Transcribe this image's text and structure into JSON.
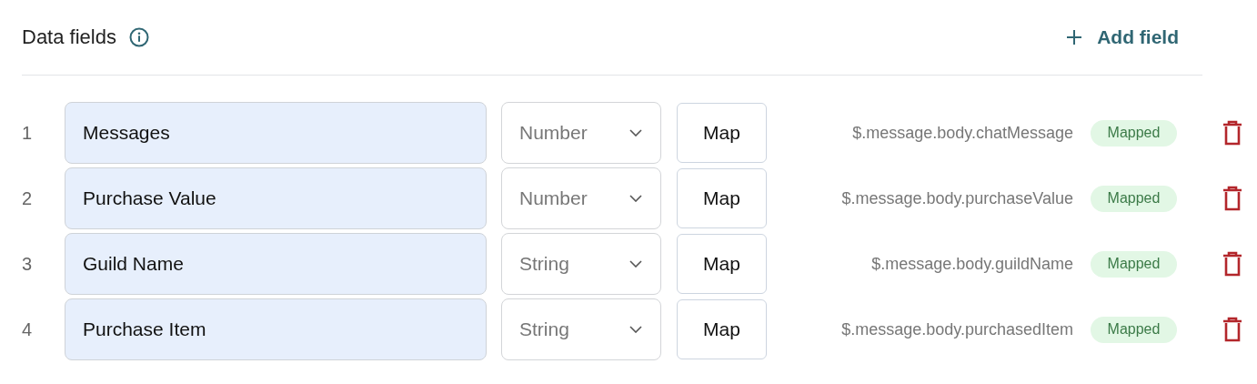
{
  "header": {
    "title": "Data fields",
    "add_button": "Add field"
  },
  "rows": [
    {
      "index": "1",
      "name": "Messages",
      "type": "Number",
      "map_button": "Map",
      "path": "$.message.body.chatMessage",
      "status": "Mapped"
    },
    {
      "index": "2",
      "name": "Purchase Value",
      "type": "Number",
      "map_button": "Map",
      "path": "$.message.body.purchaseValue",
      "status": "Mapped"
    },
    {
      "index": "3",
      "name": "Guild Name",
      "type": "String",
      "map_button": "Map",
      "path": "$.message.body.guildName",
      "status": "Mapped"
    },
    {
      "index": "4",
      "name": "Purchase Item",
      "type": "String",
      "map_button": "Map",
      "path": "$.message.body.purchasedItem",
      "status": "Mapped"
    }
  ]
}
